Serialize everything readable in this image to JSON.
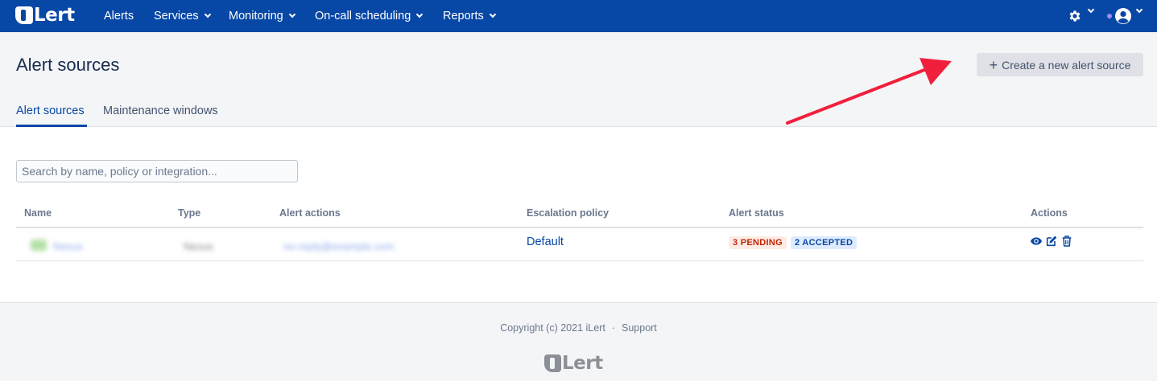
{
  "nav": {
    "logo_text": "Lert",
    "items": [
      {
        "label": "Alerts",
        "has_dropdown": false
      },
      {
        "label": "Services",
        "has_dropdown": true
      },
      {
        "label": "Monitoring",
        "has_dropdown": true
      },
      {
        "label": "On-call scheduling",
        "has_dropdown": true
      },
      {
        "label": "Reports",
        "has_dropdown": true
      }
    ],
    "settings_icon": "gear-icon",
    "user_icon": "user-circle-icon",
    "background_color": "#0747a6"
  },
  "header": {
    "title": "Alert sources",
    "create_button_label": "Create a new alert source",
    "create_button_icon": "plus-icon"
  },
  "tabs": [
    {
      "label": "Alert sources",
      "active": true
    },
    {
      "label": "Maintenance windows",
      "active": false
    }
  ],
  "search": {
    "placeholder": "Search by name, policy or integration...",
    "value": ""
  },
  "table": {
    "columns": [
      "Name",
      "Type",
      "Alert actions",
      "Escalation policy",
      "Alert status",
      "Actions"
    ],
    "rows": [
      {
        "name": "Nexus",
        "type": "Nexus",
        "alert_actions": "no-reply@example.com",
        "escalation_policy": "Default",
        "status_pending": "3 PENDING",
        "status_accepted": "2 ACCEPTED",
        "action_icons": [
          "eye-icon",
          "edit-icon",
          "trash-icon"
        ]
      }
    ]
  },
  "footer": {
    "copyright": "Copyright (c) 2021 iLert",
    "separator": "·",
    "support_label": "Support",
    "logo_text": "Lert"
  },
  "colors": {
    "accent": "#0747a6",
    "pending_bg": "#ffebe6",
    "pending_text": "#bf2600",
    "accepted_bg": "#deebff",
    "annotation_arrow": "#f0203c"
  }
}
